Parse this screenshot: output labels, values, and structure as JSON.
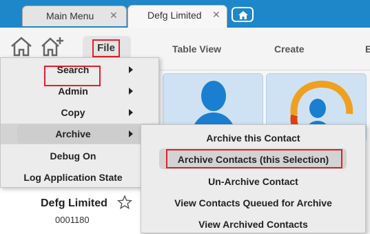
{
  "tabs": [
    {
      "label": "Main Menu",
      "close": "✕"
    },
    {
      "label": "Defg Limited",
      "close": "✕"
    }
  ],
  "toolbar": {
    "file_label": "File",
    "table_view_label": "Table View",
    "create_label": "Create",
    "partial_label": "E"
  },
  "file_menu": {
    "items": [
      {
        "label": "Search",
        "has_submenu": true
      },
      {
        "label": "Admin",
        "has_submenu": true
      },
      {
        "label": "Copy",
        "has_submenu": true
      },
      {
        "label": "Archive",
        "has_submenu": true,
        "selected": true
      },
      {
        "label": "Debug On",
        "has_submenu": false
      },
      {
        "label": "Log Application State",
        "has_submenu": false
      }
    ]
  },
  "archive_menu": {
    "items": [
      {
        "label": "Archive this Contact"
      },
      {
        "label": "Archive Contacts (this Selection)",
        "selected": true
      },
      {
        "label": "Un-Archive Contact"
      },
      {
        "label": "View Contacts Queued for Archive"
      },
      {
        "label": "View Archived Contacts"
      }
    ]
  },
  "record": {
    "name": "Defg Limited",
    "id": "0001180"
  },
  "colors": {
    "tabstrip": "#1d87c9",
    "highlight_box": "#e0202a",
    "menu_bg": "#ececec"
  }
}
